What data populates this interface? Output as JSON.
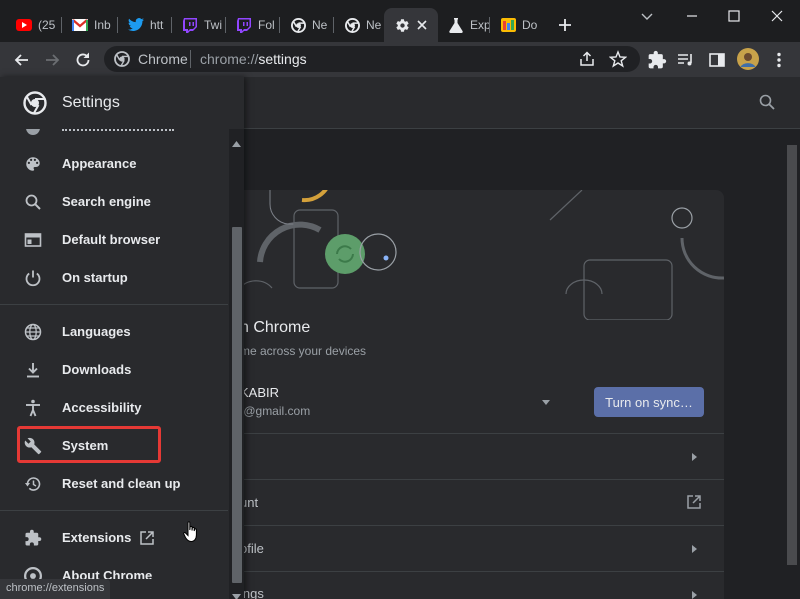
{
  "tabs": [
    {
      "label": "(25",
      "icon": "youtube-icon"
    },
    {
      "label": "Inb",
      "icon": "gmail-icon"
    },
    {
      "label": "htt",
      "icon": "twitter-icon"
    },
    {
      "label": "Twi",
      "icon": "twitch-icon"
    },
    {
      "label": "Fol",
      "icon": "twitch-icon"
    },
    {
      "label": "Ne",
      "icon": "chrome-icon"
    },
    {
      "label": "Ne",
      "icon": "chrome-icon"
    },
    {
      "label": "",
      "icon": "gear-icon",
      "active": true
    },
    {
      "label": "Exp",
      "icon": "flask-icon"
    },
    {
      "label": "Do",
      "icon": "docs-icon"
    }
  ],
  "toolbar": {
    "site_chip": "Chrome",
    "url_scheme": "chrome://",
    "url_path": "settings"
  },
  "drawer": {
    "title": "Settings",
    "items": [
      {
        "label": "Appearance",
        "icon": "palette-icon"
      },
      {
        "label": "Search engine",
        "icon": "search-icon"
      },
      {
        "label": "Default browser",
        "icon": "browser-window-icon"
      },
      {
        "label": "On startup",
        "icon": "power-icon"
      },
      {
        "label": "Languages",
        "icon": "globe-icon"
      },
      {
        "label": "Downloads",
        "icon": "download-icon"
      },
      {
        "label": "Accessibility",
        "icon": "accessibility-icon"
      },
      {
        "label": "System",
        "icon": "wrench-icon"
      },
      {
        "label": "Reset and clean up",
        "icon": "restore-icon"
      },
      {
        "label": "Extensions",
        "icon": "puzzle-icon"
      },
      {
        "label": "About Chrome",
        "icon": "chrome-icon"
      }
    ]
  },
  "main": {
    "sync_heading": "n Chrome",
    "sync_sub": "me across your devices",
    "account_name": "KABIR",
    "account_email": "t@gmail.com",
    "sync_button": "Turn on sync…",
    "rows": [
      "",
      "unt",
      "ofile",
      "ings"
    ]
  },
  "status_bar": "chrome://extensions",
  "colors": {
    "accent_button": "#5b6fa8",
    "highlight": "#e53935",
    "surface": "#292a2d",
    "background": "#202124"
  }
}
